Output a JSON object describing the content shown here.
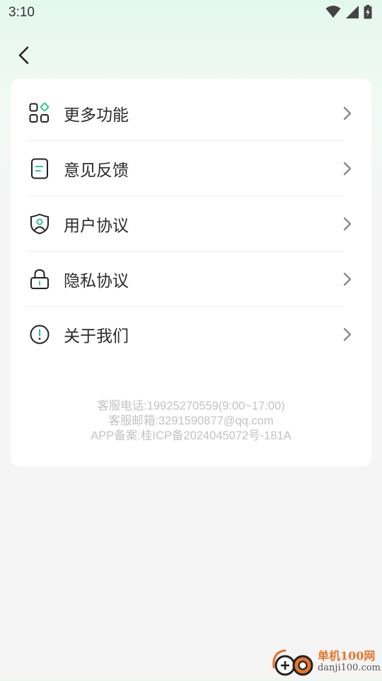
{
  "status_bar": {
    "time": "3:10",
    "icons": [
      "wifi-icon",
      "signal-icon",
      "battery-charging-icon"
    ]
  },
  "header": {
    "back_icon": "chevron-left-icon"
  },
  "menu": {
    "items": [
      {
        "label": "更多功能",
        "icon": "apps-grid-icon"
      },
      {
        "label": "意见反馈",
        "icon": "feedback-document-icon"
      },
      {
        "label": "用户协议",
        "icon": "user-shield-icon"
      },
      {
        "label": "隐私协议",
        "icon": "lock-icon"
      },
      {
        "label": "关于我们",
        "icon": "info-circle-icon"
      }
    ],
    "chevron_icon": "chevron-right-icon"
  },
  "footer": {
    "service_phone": "客服电话:19925270559(9:00~17:00)",
    "service_email": "客服邮箱:3291590877@qq.com",
    "app_record": "APP备案:桂ICP备2024045072号-181A"
  },
  "watermark": {
    "title": "单机100网",
    "subtitle": "danji100.com"
  },
  "colors": {
    "accent": "#2cc990",
    "text": "#2b2b2b",
    "footer_text": "#c3c3c3",
    "chevron": "#8a8a8a"
  }
}
